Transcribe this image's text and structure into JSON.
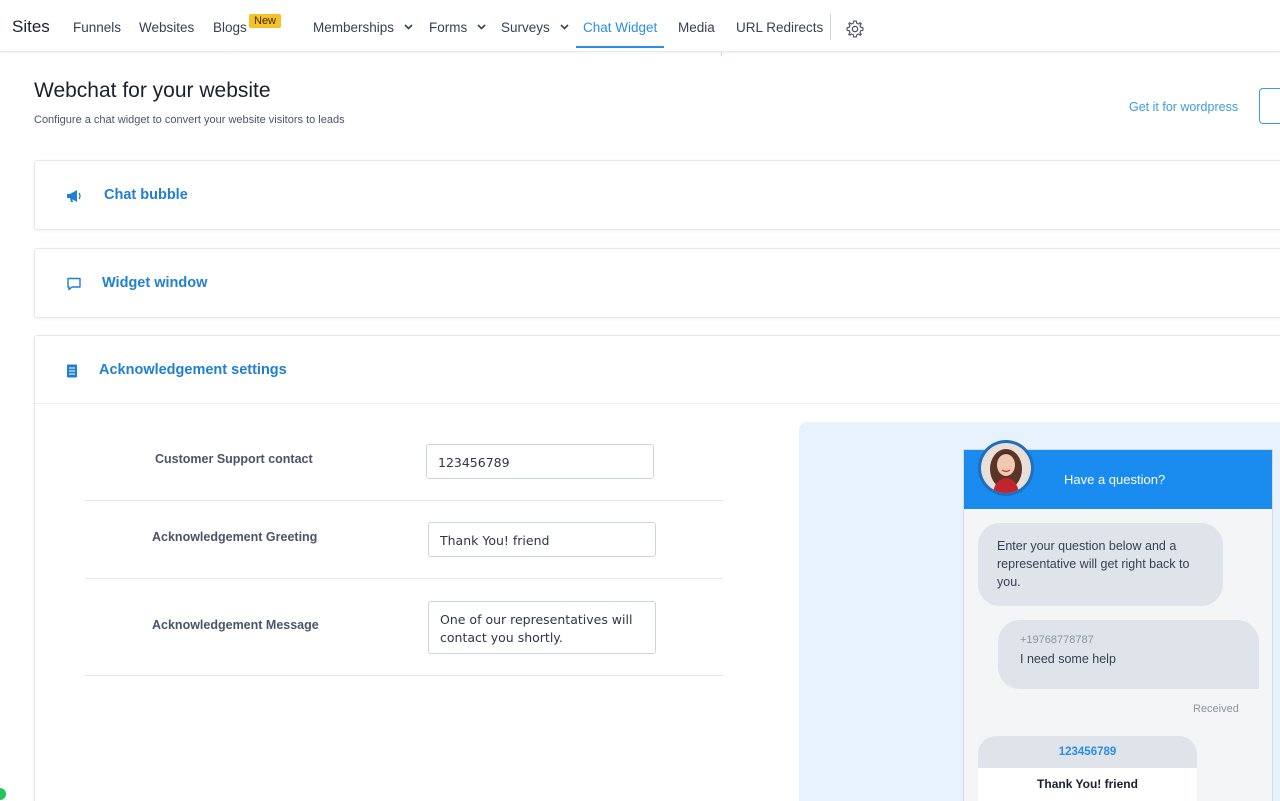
{
  "nav": {
    "brand": "Sites",
    "items": [
      "Funnels",
      "Websites",
      "Blogs",
      "Memberships",
      "Forms",
      "Surveys",
      "Chat Widget",
      "Media",
      "URL Redirects"
    ],
    "blogs_badge": "New",
    "active_item": "Chat Widget",
    "dropdown_icon": "chevron-down-icon",
    "settings_icon": "gear-icon"
  },
  "header": {
    "title": "Webchat for your website",
    "subtitle": "Configure a chat widget to convert your website visitors to leads",
    "wordpress_link": "Get it for wordpress"
  },
  "sections": {
    "chat_bubble": {
      "title": "Chat bubble",
      "icon": "megaphone-icon"
    },
    "widget_window": {
      "title": "Widget window",
      "icon": "message-square-icon"
    },
    "acknowledgement": {
      "title": "Acknowledgement settings",
      "icon": "document-icon"
    }
  },
  "ack_form": {
    "support_contact_label": "Customer Support contact",
    "support_contact_value": "123456789",
    "greeting_label": "Acknowledgement Greeting",
    "greeting_value": "Thank You! friend",
    "message_label": "Acknowledgement Message",
    "message_value": "One of our representatives will contact you shortly."
  },
  "preview": {
    "header_text": "Have a question?",
    "intro_message": "Enter your question below and a representative will get right back to you.",
    "visitor_phone": "+19768778787",
    "visitor_message": "I need some help",
    "status": "Received",
    "ack_contact": "123456789",
    "ack_greeting": "Thank You! friend"
  },
  "colors": {
    "accent": "#2b8ee6",
    "widget_header": "#1a8cf0",
    "badge": "#f6c026",
    "preview_bg": "#e7f2fc"
  }
}
